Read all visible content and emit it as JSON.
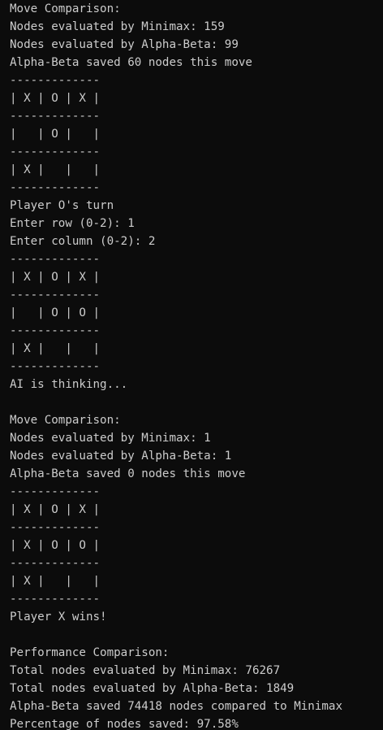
{
  "terminal": {
    "lines": [
      "Move Comparison:",
      "Nodes evaluated by Minimax: 159",
      "Nodes evaluated by Alpha-Beta: 99",
      "Alpha-Beta saved 60 nodes this move",
      "-------------",
      "| X | O | X |",
      "-------------",
      "|   | O |   |",
      "-------------",
      "| X |   |   |",
      "-------------",
      "Player O's turn",
      "Enter row (0-2): 1",
      "Enter column (0-2): 2",
      "-------------",
      "| X | O | X |",
      "-------------",
      "|   | O | O |",
      "-------------",
      "| X |   |   |",
      "-------------",
      "AI is thinking...",
      "",
      "Move Comparison:",
      "Nodes evaluated by Minimax: 1",
      "Nodes evaluated by Alpha-Beta: 1",
      "Alpha-Beta saved 0 nodes this move",
      "-------------",
      "| X | O | X |",
      "-------------",
      "| X | O | O |",
      "-------------",
      "| X |   |   |",
      "-------------",
      "Player X wins!",
      "",
      "Performance Comparison:",
      "Total nodes evaluated by Minimax: 76267",
      "Total nodes evaluated by Alpha-Beta: 1849",
      "Alpha-Beta saved 74418 nodes compared to Minimax",
      "Percentage of nodes saved: 97.58%"
    ]
  },
  "colors": {
    "background": "#0c0c0c",
    "text": "#cccccc"
  }
}
